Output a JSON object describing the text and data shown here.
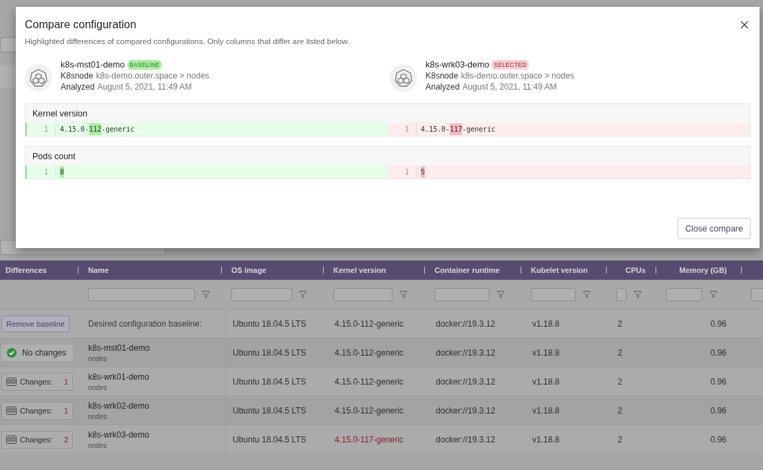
{
  "dialog": {
    "title": "Compare configuration",
    "subtitle": "Highlighted differences of compared configurations. Only columns that differ are listed below.",
    "nodes": [
      {
        "name": "k8s-mst01-demo",
        "badge": {
          "label": "BASELINE",
          "kind": "baseline"
        },
        "type": "K8snode",
        "path": "k8s-demo.outer.space > nodes",
        "analyzed_label": "Analyzed",
        "analyzed": "August 5, 2021, 11:49 AM"
      },
      {
        "name": "k8s-wrk03-demo",
        "badge": {
          "label": "SELECTED",
          "kind": "selected"
        },
        "type": "K8snode",
        "path": "k8s-demo.outer.space > nodes",
        "analyzed_label": "Analyzed",
        "analyzed": "August 5, 2021, 11:49 AM"
      }
    ],
    "sections": [
      {
        "title": "Kernel version",
        "left": {
          "line": "1",
          "segments": [
            {
              "text": "4.15.0-",
              "changed": false
            },
            {
              "text": "112",
              "changed": true
            },
            {
              "text": "-generic",
              "changed": false
            }
          ]
        },
        "right": {
          "line": "1",
          "segments": [
            {
              "text": "4.15.0-",
              "changed": false
            },
            {
              "text": "117",
              "changed": true
            },
            {
              "text": "-generic",
              "changed": false
            }
          ]
        }
      },
      {
        "title": "Pods count",
        "left": {
          "line": "1",
          "segments": [
            {
              "text": "8",
              "changed": true
            }
          ]
        },
        "right": {
          "line": "1",
          "segments": [
            {
              "text": "5",
              "changed": true
            }
          ]
        }
      }
    ],
    "close_button": "Close compare"
  },
  "table": {
    "columns": [
      {
        "label": "Differences",
        "filter": false
      },
      {
        "label": "Name",
        "filter": true
      },
      {
        "label": "OS image",
        "filter": true
      },
      {
        "label": "Kernel version",
        "filter": true
      },
      {
        "label": "Container runtime",
        "filter": true
      },
      {
        "label": "Kubelet version",
        "filter": true
      },
      {
        "label": "CPUs",
        "filter": true
      },
      {
        "label": "Memory (GB)",
        "filter": true
      },
      {
        "filter": true
      }
    ],
    "rows": [
      {
        "differences": {
          "kind": "button",
          "label": "Remove baseline"
        },
        "name": "Desired configuration baseline:",
        "os_image": "Ubuntu 18.04.5 LTS",
        "kernel_version": "4.15.0-112-generic",
        "kernel_changed": false,
        "container_runtime": "docker://19.3.12",
        "kubelet_version": "v1.18.8",
        "cpus": "2",
        "memory": "0.96"
      },
      {
        "differences": {
          "kind": "status",
          "label": "No changes"
        },
        "name": "k8s-mst01-demo",
        "sub": "nodes",
        "os_image": "Ubuntu 18.04.5 LTS",
        "kernel_version": "4.15.0-112-generic",
        "kernel_changed": false,
        "container_runtime": "docker://19.3.12",
        "kubelet_version": "v1.18.8",
        "cpus": "2",
        "memory": "0.96"
      },
      {
        "differences": {
          "kind": "changes",
          "label": "Changes:",
          "count": "1"
        },
        "name": "k8s-wrk01-demo",
        "sub": "nodes",
        "os_image": "Ubuntu 18.04.5 LTS",
        "kernel_version": "4.15.0-112-generic",
        "kernel_changed": false,
        "container_runtime": "docker://19.3.12",
        "kubelet_version": "v1.18.8",
        "cpus": "2",
        "memory": "0.96"
      },
      {
        "differences": {
          "kind": "changes",
          "label": "Changes:",
          "count": "1"
        },
        "name": "k8s-wrk02-demo",
        "sub": "nodes",
        "os_image": "Ubuntu 18.04.5 LTS",
        "kernel_version": "4.15.0-112-generic",
        "kernel_changed": false,
        "container_runtime": "docker://19.3.12",
        "kubelet_version": "v1.18.8",
        "cpus": "2",
        "memory": "0.96"
      },
      {
        "differences": {
          "kind": "changes",
          "label": "Changes:",
          "count": "2"
        },
        "name": "k8s-wrk03-demo",
        "sub": "nodes",
        "os_image": "Ubuntu 18.04.5 LTS",
        "kernel_version": "4.15.0-117-generic",
        "kernel_changed": true,
        "container_runtime": "docker://19.3.12",
        "kubelet_version": "v1.18.8",
        "cpus": "2",
        "memory": "0.96"
      }
    ]
  }
}
